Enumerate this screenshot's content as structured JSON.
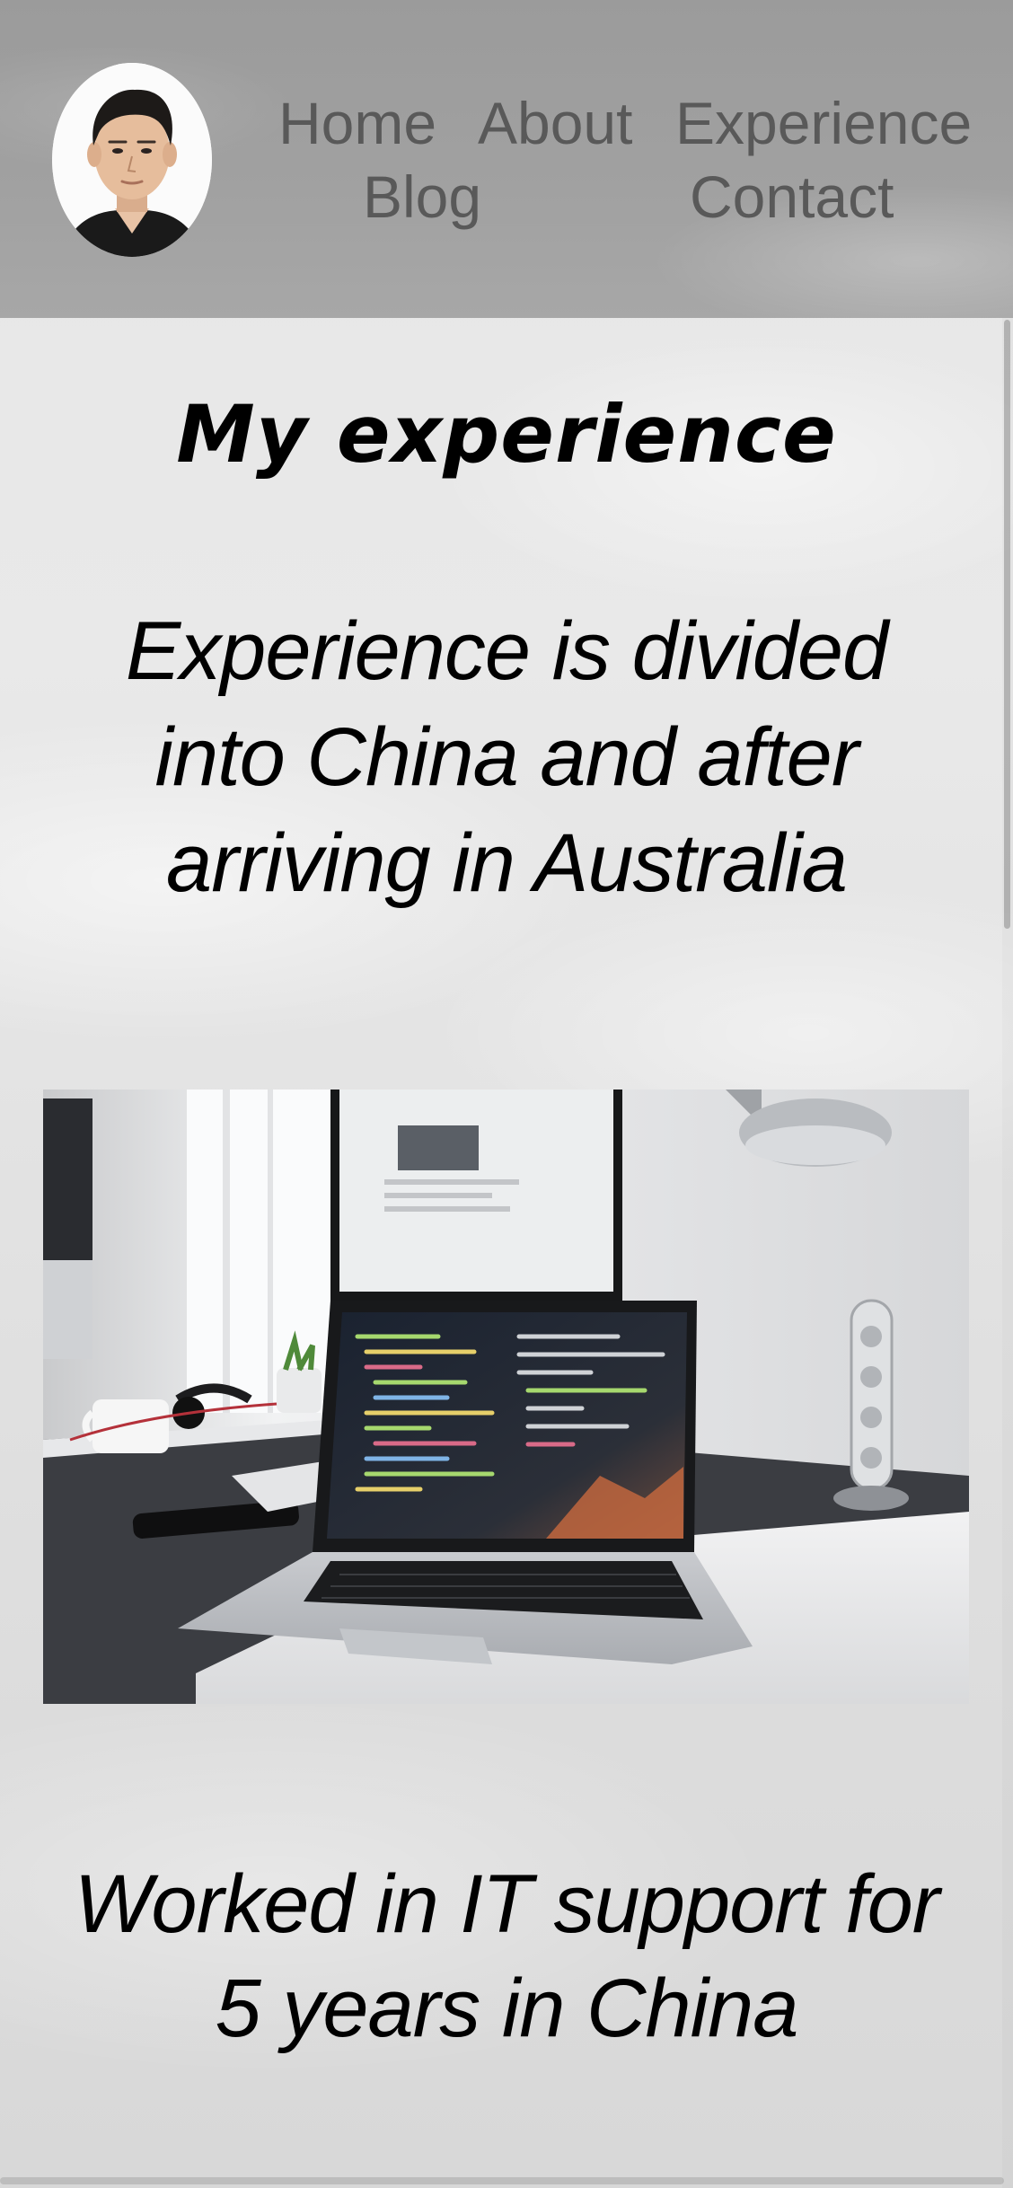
{
  "header": {
    "avatar_alt": "profile photo",
    "nav": {
      "home": "Home",
      "about": "About",
      "experience": "Experience",
      "blog": "Blog",
      "contact": "Contact"
    }
  },
  "main": {
    "title": "My experience",
    "intro": "Experience is divided into China and after arriving in Australia",
    "image": {
      "description_icon": "laptop-desk-photo"
    },
    "items": [
      "Worked in IT support for 5 years in China"
    ]
  },
  "colors": {
    "header_bg": "#9e9e9e",
    "nav_text": "#595959",
    "page_bg": "#e4e4e4",
    "text": "#000000"
  }
}
